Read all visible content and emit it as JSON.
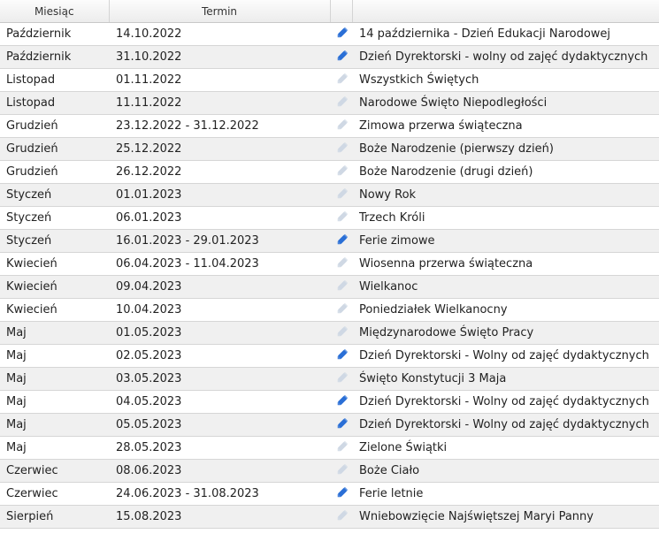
{
  "headers": {
    "month": "Miesiąc",
    "term": "Termin",
    "icon": "",
    "description": ""
  },
  "colors": {
    "active_icon": "#2a6fd6",
    "inactive_icon": "#cfd8e4"
  },
  "rows": [
    {
      "month": "Październik",
      "term": "14.10.2022",
      "description": "14 października - Dzień Edukacji Narodowej",
      "icon": "pencil-icon-active"
    },
    {
      "month": "Październik",
      "term": "31.10.2022",
      "description": "Dzień Dyrektorski - wolny od zajęć dydaktycznych",
      "icon": "pencil-icon-active"
    },
    {
      "month": "Listopad",
      "term": "01.11.2022",
      "description": "Wszystkich Świętych",
      "icon": "pencil-icon-inactive"
    },
    {
      "month": "Listopad",
      "term": "11.11.2022",
      "description": "Narodowe Święto Niepodległości",
      "icon": "pencil-icon-inactive"
    },
    {
      "month": "Grudzień",
      "term": "23.12.2022 - 31.12.2022",
      "description": "Zimowa przerwa świąteczna",
      "icon": "pencil-icon-inactive"
    },
    {
      "month": "Grudzień",
      "term": "25.12.2022",
      "description": "Boże Narodzenie (pierwszy dzień)",
      "icon": "pencil-icon-inactive"
    },
    {
      "month": "Grudzień",
      "term": "26.12.2022",
      "description": "Boże Narodzenie (drugi dzień)",
      "icon": "pencil-icon-inactive"
    },
    {
      "month": "Styczeń",
      "term": "01.01.2023",
      "description": "Nowy Rok",
      "icon": "pencil-icon-inactive"
    },
    {
      "month": "Styczeń",
      "term": "06.01.2023",
      "description": "Trzech Króli",
      "icon": "pencil-icon-inactive"
    },
    {
      "month": "Styczeń",
      "term": "16.01.2023 - 29.01.2023",
      "description": "Ferie zimowe",
      "icon": "pencil-icon-active"
    },
    {
      "month": "Kwiecień",
      "term": "06.04.2023 - 11.04.2023",
      "description": "Wiosenna przerwa świąteczna",
      "icon": "pencil-icon-inactive"
    },
    {
      "month": "Kwiecień",
      "term": "09.04.2023",
      "description": "Wielkanoc",
      "icon": "pencil-icon-inactive"
    },
    {
      "month": "Kwiecień",
      "term": "10.04.2023",
      "description": "Poniedziałek Wielkanocny",
      "icon": "pencil-icon-inactive"
    },
    {
      "month": "Maj",
      "term": "01.05.2023",
      "description": "Międzynarodowe Święto Pracy",
      "icon": "pencil-icon-inactive"
    },
    {
      "month": "Maj",
      "term": "02.05.2023",
      "description": "Dzień Dyrektorski - Wolny od zajęć dydaktycznych",
      "icon": "pencil-icon-active"
    },
    {
      "month": "Maj",
      "term": "03.05.2023",
      "description": "Święto Konstytucji 3 Maja",
      "icon": "pencil-icon-inactive"
    },
    {
      "month": "Maj",
      "term": "04.05.2023",
      "description": "Dzień Dyrektorski - Wolny od zajęć dydaktycznych",
      "icon": "pencil-icon-active"
    },
    {
      "month": "Maj",
      "term": "05.05.2023",
      "description": "Dzień Dyrektorski - Wolny od zajęć dydaktycznych",
      "icon": "pencil-icon-active"
    },
    {
      "month": "Maj",
      "term": "28.05.2023",
      "description": "Zielone Świątki",
      "icon": "pencil-icon-inactive"
    },
    {
      "month": "Czerwiec",
      "term": "08.06.2023",
      "description": "Boże Ciało",
      "icon": "pencil-icon-inactive"
    },
    {
      "month": "Czerwiec",
      "term": "24.06.2023 - 31.08.2023",
      "description": "Ferie letnie",
      "icon": "pencil-icon-active"
    },
    {
      "month": "Sierpień",
      "term": "15.08.2023",
      "description": "Wniebowzięcie Najświętszej Maryi Panny",
      "icon": "pencil-icon-inactive"
    }
  ]
}
